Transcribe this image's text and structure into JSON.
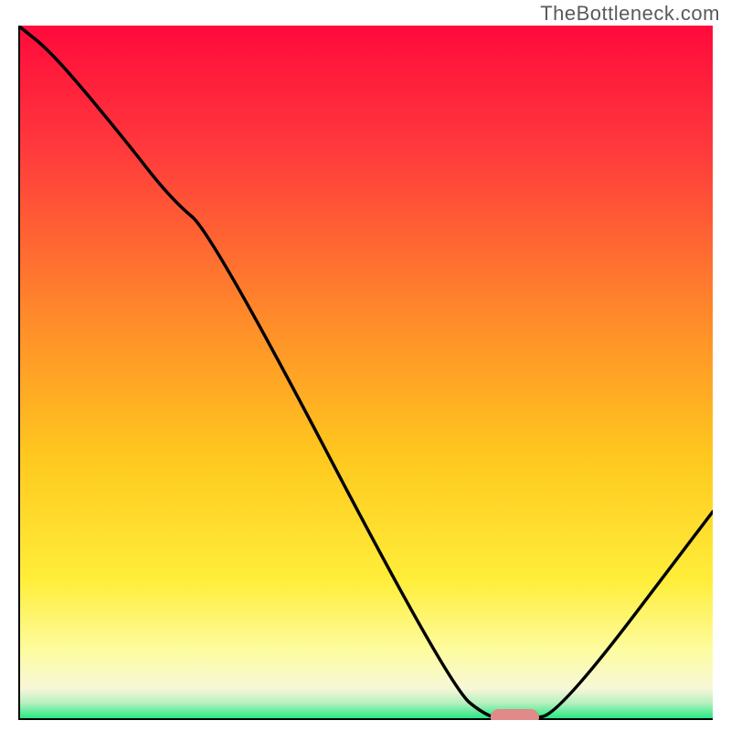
{
  "watermark": "TheBottleneck.com",
  "colors": {
    "axis": "#000000",
    "curve": "#000000",
    "marker_fill": "#e08a8a",
    "gradient_stops": [
      {
        "offset": 0.0,
        "color": "#ff0a3c"
      },
      {
        "offset": 0.18,
        "color": "#ff3a3c"
      },
      {
        "offset": 0.42,
        "color": "#ff8a2a"
      },
      {
        "offset": 0.62,
        "color": "#ffc81e"
      },
      {
        "offset": 0.8,
        "color": "#ffee3a"
      },
      {
        "offset": 0.9,
        "color": "#fdfca0"
      },
      {
        "offset": 0.955,
        "color": "#f7f7d8"
      },
      {
        "offset": 0.975,
        "color": "#b8f0c0"
      },
      {
        "offset": 1.0,
        "color": "#17e87a"
      }
    ]
  },
  "chart_data": {
    "type": "line",
    "title": "",
    "xlabel": "",
    "ylabel": "",
    "xlim": [
      0,
      100
    ],
    "ylim": [
      0,
      100
    ],
    "x": [
      0,
      5,
      15,
      22,
      28,
      62,
      68,
      73,
      78,
      100
    ],
    "values": [
      100,
      96,
      84,
      75,
      70,
      5,
      0,
      0,
      1,
      30
    ],
    "marker": {
      "x_start": 68,
      "x_end": 75,
      "y": 0
    }
  }
}
